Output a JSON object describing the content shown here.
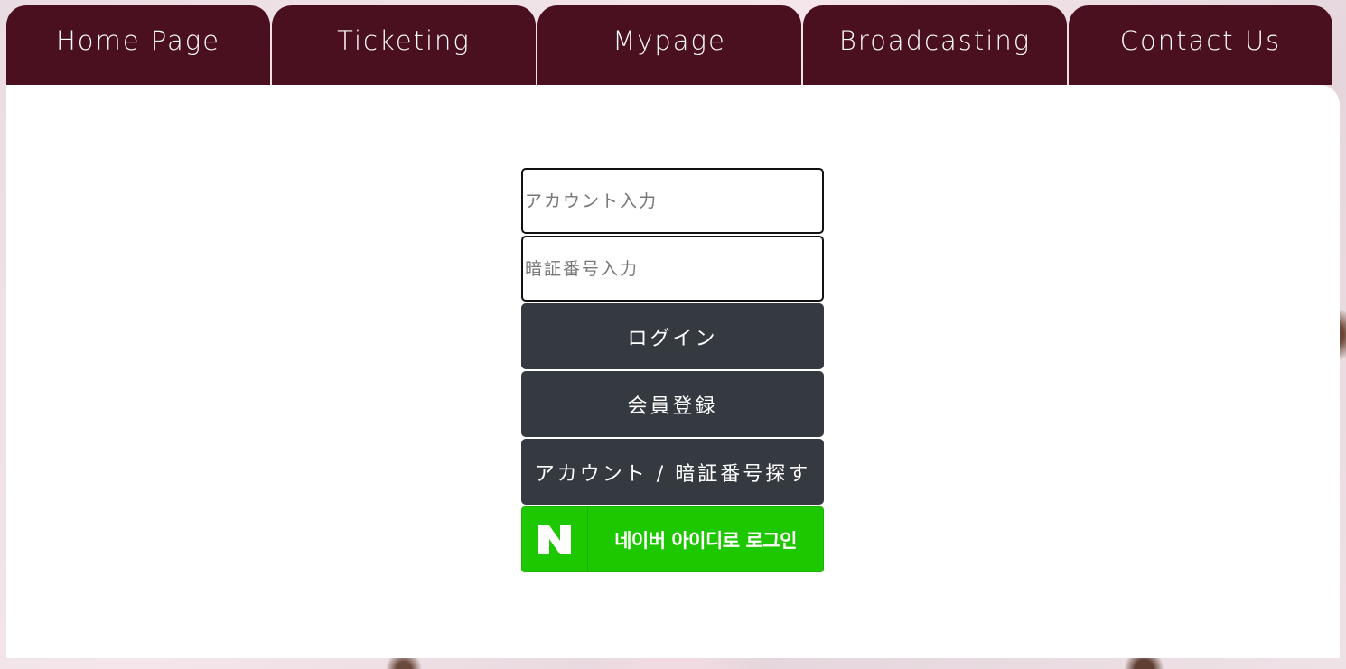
{
  "nav": {
    "tabs": [
      {
        "label": "Home Page"
      },
      {
        "label": "Ticketing"
      },
      {
        "label": "Mypage"
      },
      {
        "label": "Broadcasting"
      },
      {
        "label": "Contact Us"
      }
    ]
  },
  "login": {
    "account_placeholder": "アカウント入力",
    "account_value": "",
    "password_placeholder": "暗証番号入力",
    "password_value": "",
    "login_button": "ログイン",
    "register_button": "会員登録",
    "find_button": "アカウント / 暗証番号探す",
    "naver_button": "네이버 아이디로 로그인",
    "naver_icon": "naver-n-icon"
  },
  "colors": {
    "nav_bg": "#4a1020",
    "button_bg": "#343a40",
    "naver_green": "#1ec800"
  }
}
